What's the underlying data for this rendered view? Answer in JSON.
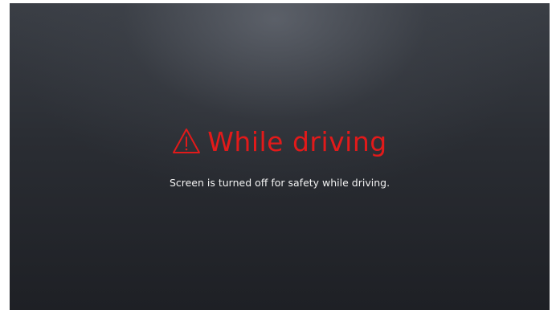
{
  "warning": {
    "icon": "warning-triangle-icon",
    "title": "While driving",
    "message": "Screen is turned off for safety while driving.",
    "accent_color": "#e21a1a"
  }
}
